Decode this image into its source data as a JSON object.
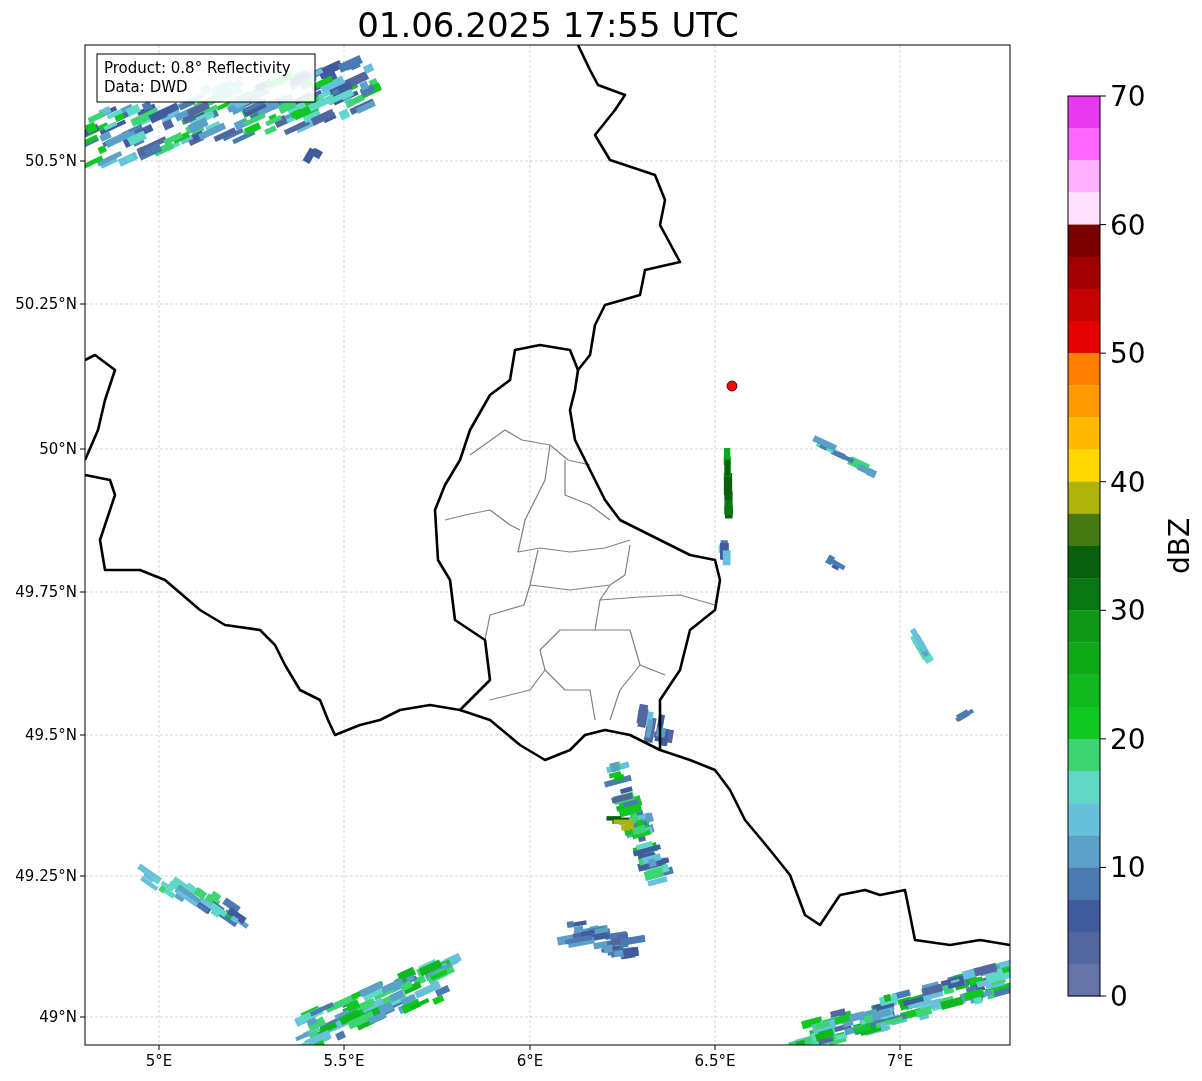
{
  "title": "01.06.2025 17:55 UTC",
  "info_box": [
    "Product: 0.8° Reflectivity",
    "Data: DWD"
  ],
  "map": {
    "x_ticks": [
      "5°E",
      "5.5°E",
      "6°E",
      "6.5°E",
      "7°E"
    ],
    "y_ticks": [
      "50.5°N",
      "50.25°N",
      "50°N",
      "49.75°N",
      "49.5°N",
      "49.25°N",
      "49°N"
    ]
  },
  "colorbar": {
    "label": "dBZ",
    "ticks": [
      "70",
      "60",
      "50",
      "40",
      "30",
      "20",
      "10",
      "0"
    ],
    "segments": [
      {
        "color": "#e838f0"
      },
      {
        "color": "#ff66ff"
      },
      {
        "color": "#ffb0ff"
      },
      {
        "color": "#ffe0ff"
      },
      {
        "color": "#7a0000"
      },
      {
        "color": "#a00000"
      },
      {
        "color": "#c40000"
      },
      {
        "color": "#e40000"
      },
      {
        "color": "#ff7e00"
      },
      {
        "color": "#ff9a00"
      },
      {
        "color": "#ffb800"
      },
      {
        "color": "#ffd800"
      },
      {
        "color": "#aeb40a"
      },
      {
        "color": "#467a10"
      },
      {
        "color": "#08600c"
      },
      {
        "color": "#0a7812"
      },
      {
        "color": "#0d9816"
      },
      {
        "color": "#0ea818"
      },
      {
        "color": "#10b820"
      },
      {
        "color": "#10c820"
      },
      {
        "color": "#3dd472"
      },
      {
        "color": "#5fd8c8"
      },
      {
        "color": "#68c0dc"
      },
      {
        "color": "#5aa0c8"
      },
      {
        "color": "#4a7ab0"
      },
      {
        "color": "#405c9e"
      },
      {
        "color": "#5266a0"
      },
      {
        "color": "#6573a6"
      }
    ]
  }
}
